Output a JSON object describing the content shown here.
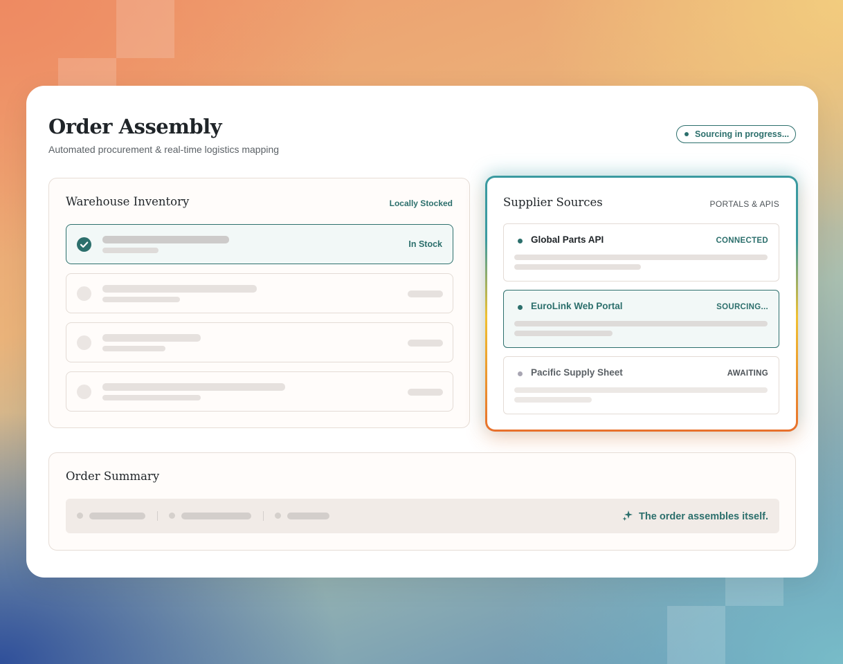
{
  "header": {
    "title": "Order Assembly",
    "subtitle": "Automated procurement & real-time logistics mapping",
    "status": "Sourcing in progress..."
  },
  "warehouse": {
    "title": "Warehouse Inventory",
    "tag": "Locally Stocked",
    "first_item_status": "In Stock"
  },
  "suppliers": {
    "title": "Supplier Sources",
    "tag": "PORTALS & APIS",
    "items": [
      {
        "name": "Global Parts API",
        "status": "CONNECTED"
      },
      {
        "name": "EuroLink Web Portal",
        "status": "SOURCING..."
      },
      {
        "name": "Pacific Supply Sheet",
        "status": "AWAITING"
      }
    ]
  },
  "summary": {
    "title": "Order Summary",
    "message": "The order assembles itself."
  },
  "colors": {
    "accent": "#2c6f6c",
    "muted": "#5b6166",
    "awaiting_dot": "#a8a6b3"
  },
  "icons": {
    "check": "check-icon",
    "status_dot": "status-dot-icon",
    "sparkle": "sparkle-icon"
  }
}
